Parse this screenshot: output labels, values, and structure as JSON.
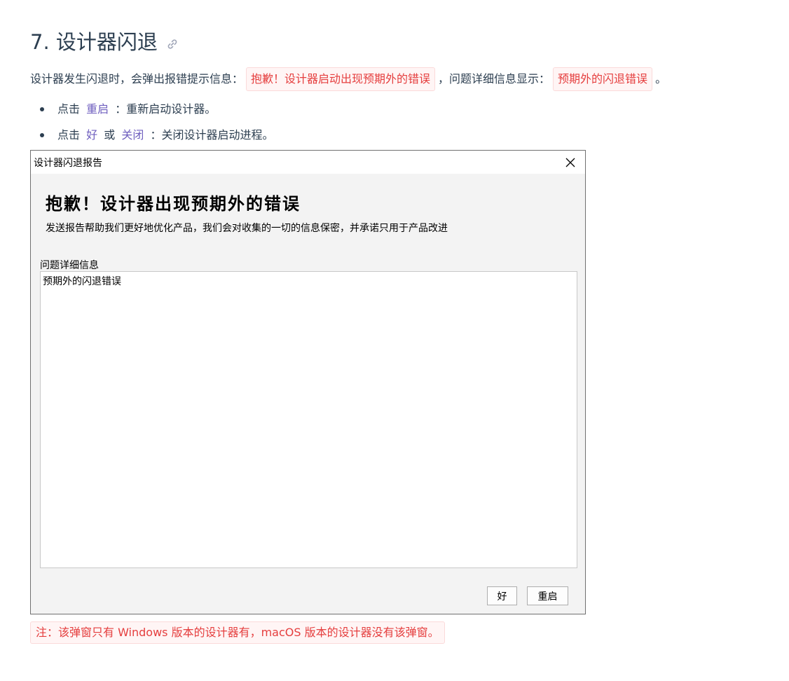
{
  "heading": {
    "title": "7. 设计器闪退",
    "anchor_icon": "link-icon"
  },
  "intro": {
    "text_before": "设计器发生闪退时，会弹出报错提示信息：",
    "code_1": "抱歉！设计器启动出现预期外的错误",
    "text_middle": "，问题详细信息显示：",
    "code_2": "预期外的闪退错误",
    "text_after": "。"
  },
  "list": {
    "item1": {
      "prefix": "点击",
      "link": "重启",
      "suffix": "：重新启动设计器。"
    },
    "item2": {
      "prefix": "点击",
      "link1": "好",
      "conj": "或",
      "link2": "关闭",
      "suffix": "：关闭设计器启动进程。"
    }
  },
  "dialog": {
    "window_title": "设计器闪退报告",
    "close_icon": "close-icon",
    "title": "抱歉！设计器出现预期外的错误",
    "subtitle": "发送报告帮助我们更好地优化产品，我们会对收集的一切的信息保密，并承诺只用于产品改进",
    "detail_label": "问题详细信息",
    "detail_value": "预期外的闪退错误",
    "ok_label": "好",
    "restart_label": "重启"
  },
  "note": "注：该弹窗只有 Windows 版本的设计器有，macOS 版本的设计器没有该弹窗。",
  "colors": {
    "text": "#2c3e50",
    "code_text": "#e53e3e",
    "code_bg": "#fff5f5",
    "link": "#6f5fbf"
  }
}
